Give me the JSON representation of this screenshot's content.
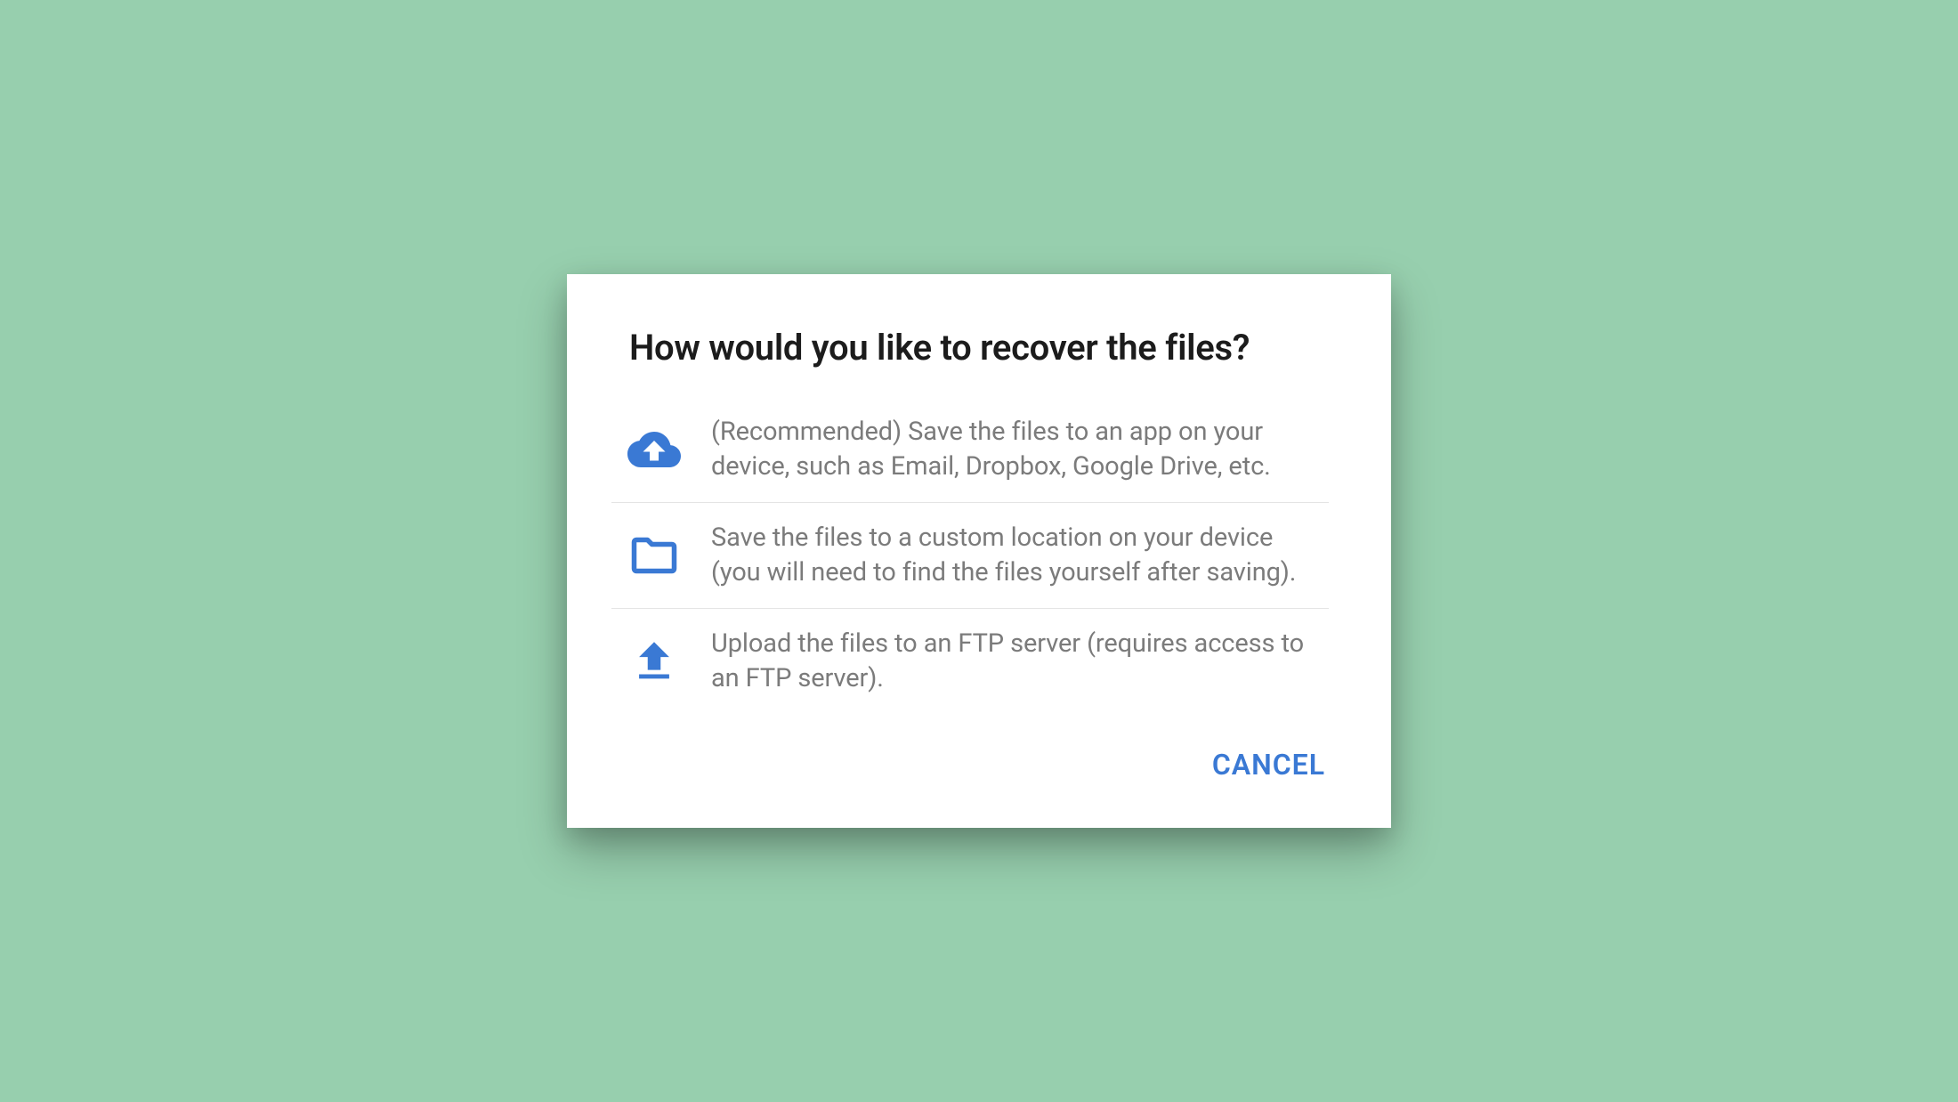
{
  "dialog": {
    "title": "How would you like to recover the files?",
    "options": [
      {
        "icon": "cloud-upload-icon",
        "text": "(Recommended) Save the files to an app on your device, such as Email, Dropbox, Google Drive, etc."
      },
      {
        "icon": "folder-icon",
        "text": "Save the files to a custom location on your device (you will need to find the files yourself after saving)."
      },
      {
        "icon": "upload-icon",
        "text": "Upload the files to an FTP server (requires access to an FTP server)."
      }
    ],
    "cancel_label": "CANCEL"
  },
  "colors": {
    "accent": "#3a79d4",
    "background": "#97cfae",
    "text_secondary": "#7b7b7b"
  }
}
